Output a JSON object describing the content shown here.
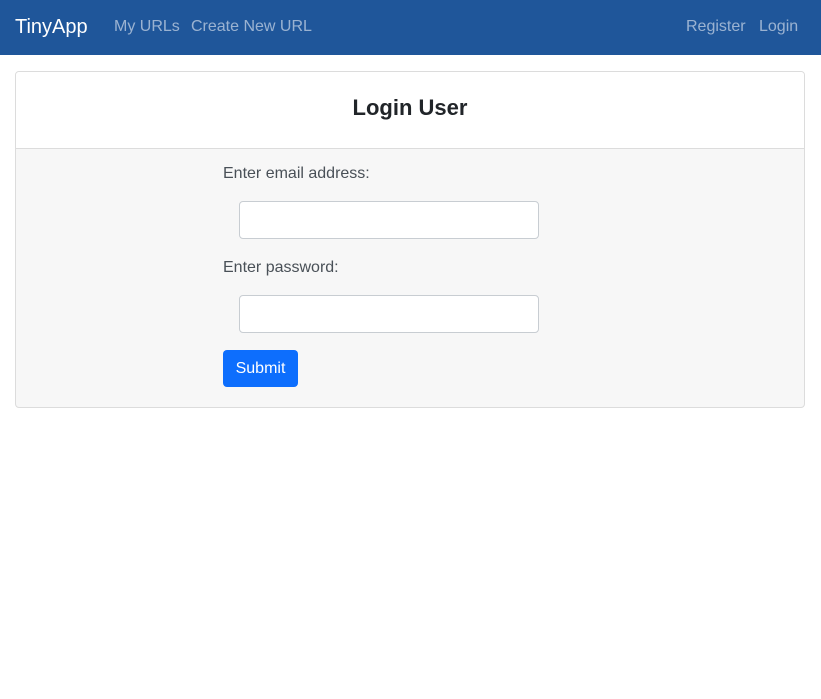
{
  "navbar": {
    "brand": "TinyApp",
    "links_left": [
      "My URLs",
      "Create New URL"
    ],
    "links_right": [
      "Register",
      "Login"
    ],
    "background_color": "#1f569a"
  },
  "card": {
    "title": "Login User"
  },
  "form": {
    "email_label": "Enter email address:",
    "email_value": "",
    "password_label": "Enter password:",
    "password_value": "",
    "submit_label": "Submit",
    "submit_color": "#0d6efd"
  }
}
